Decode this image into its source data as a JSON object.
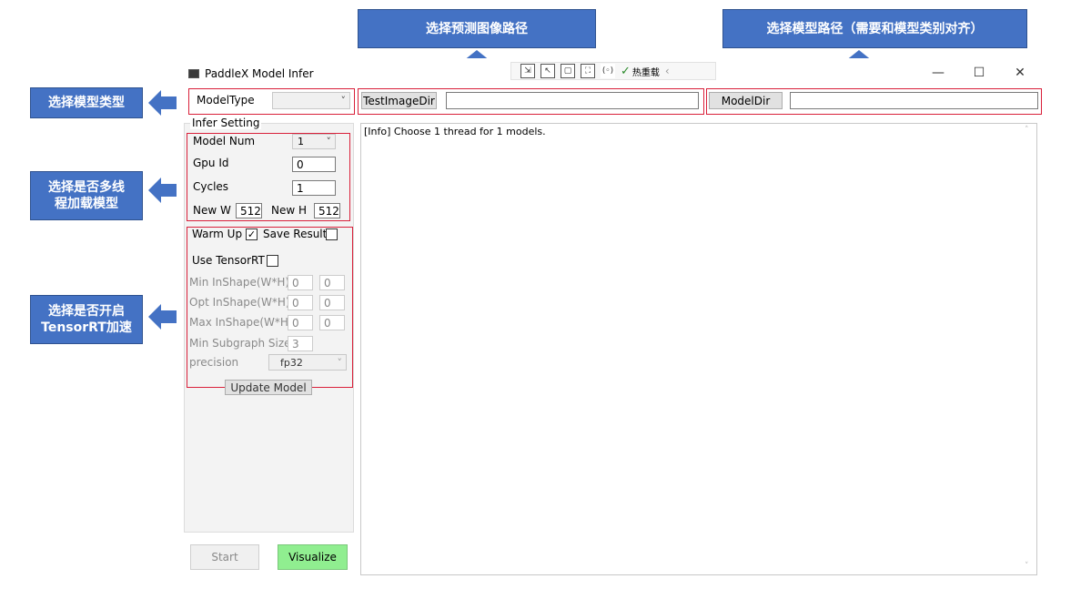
{
  "callouts": {
    "image_path": "选择预测图像路径",
    "model_path": "选择模型路径（需要和模型类别对齐）",
    "model_type": "选择模型类型",
    "multithread_line1": "选择是否多线",
    "multithread_line2": "程加载模型",
    "tensorrt_line1": "选择是否开启",
    "tensorrt_line2": "TensorRT加速"
  },
  "colors": {
    "callout_bg": "#4472c4",
    "highlight": "#d9203a",
    "visualize_bg": "#90ee90"
  },
  "window": {
    "title": "PaddleX Model Infer",
    "hot_reload": "热重载",
    "minimize": "—",
    "maximize": "☐",
    "close": "✕"
  },
  "top": {
    "model_type_label": "ModelType",
    "model_type_value": "",
    "test_image_btn": "TestImageDir",
    "test_image_value": "",
    "model_dir_btn": "ModelDir",
    "model_dir_value": ""
  },
  "infer": {
    "group_title": "Infer Setting",
    "model_num_label": "Model Num",
    "model_num_value": "1",
    "gpu_id_label": "Gpu Id",
    "gpu_id_value": "0",
    "cycles_label": "Cycles",
    "cycles_value": "1",
    "new_w_label": "New W",
    "new_w_value": "512",
    "new_h_label": "New H",
    "new_h_value": "512",
    "warm_up_label": "Warm Up",
    "warm_up_checked": "✓",
    "save_result_label": "Save Result",
    "use_trt_label": "Use TensorRT",
    "min_shape_label": "Min InShape(W*H)",
    "min_w": "0",
    "min_h": "0",
    "opt_shape_label": "Opt InShape(W*H)",
    "opt_w": "0",
    "opt_h": "0",
    "max_shape_label": "Max InShape(W*H)",
    "max_w": "0",
    "max_h": "0",
    "min_subgraph_label": "Min Subgraph Size",
    "min_subgraph_value": "3",
    "precision_label": "precision",
    "precision_value": "fp32",
    "update_btn": "Update Model"
  },
  "actions": {
    "start": "Start",
    "visualize": "Visualize"
  },
  "log": {
    "line1": "[Info] Choose 1 thread for 1 models."
  }
}
